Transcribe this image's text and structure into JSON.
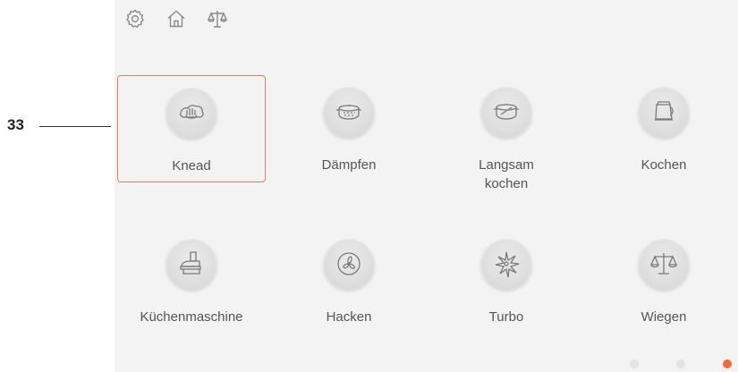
{
  "callout": {
    "number": "33"
  },
  "topbar": {
    "icons": [
      {
        "name": "settings",
        "icon": "gear-icon"
      },
      {
        "name": "home",
        "icon": "home-icon"
      },
      {
        "name": "scale",
        "icon": "scale-icon"
      }
    ]
  },
  "modes": [
    {
      "label": "Knead",
      "icon": "knead-icon",
      "selected": true
    },
    {
      "label": "Dämpfen",
      "icon": "steam-pot-icon",
      "selected": false
    },
    {
      "label": "Langsam\nkochen",
      "icon": "slow-cook-icon",
      "selected": false
    },
    {
      "label": "Kochen",
      "icon": "kettle-icon",
      "selected": false
    },
    {
      "label": "Küchenmaschine",
      "icon": "food-processor-icon",
      "selected": false
    },
    {
      "label": "Hacken",
      "icon": "chop-icon",
      "selected": false
    },
    {
      "label": "Turbo",
      "icon": "turbo-icon",
      "selected": false
    },
    {
      "label": "Wiegen",
      "icon": "scale-icon",
      "selected": false
    }
  ],
  "pagination": {
    "pages": 3,
    "active_page": 3
  },
  "colors": {
    "accent": "#ef6a3c",
    "selection_border": "#e3805f",
    "label": "#555555",
    "background": "#f3f3f3"
  }
}
